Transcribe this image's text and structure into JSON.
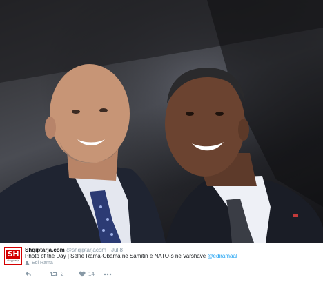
{
  "photo": {
    "alt_icon": "selfie-photo",
    "colors": {
      "background": "#2f3035",
      "suit": "#1e2330",
      "shirt": "#e6e9f2",
      "skin_left": "#c79576",
      "skin_right": "#6b4330",
      "tie_left": "#2c3b74",
      "tie_right": "#3a3d45"
    }
  },
  "tweet": {
    "avatar": {
      "logo_text": "SH",
      "logo_sub": "shqiptarja",
      "color": "#d40000"
    },
    "author_name": "Shqiptarja.com",
    "handle": "@shqiptarjacom",
    "separator": "·",
    "timestamp": "Jul 8",
    "text": "Photo of the Day | Selfie Rama-Obama në Samitin e NATO-s në Varshavë",
    "mention": "@ediramaal",
    "retweeted_by": "Edi Rama",
    "actions": {
      "reply_icon": "reply-icon",
      "retweet_count": "2",
      "like_count": "14",
      "more_icon": "more-icon"
    },
    "accent": "#1da1f2"
  }
}
